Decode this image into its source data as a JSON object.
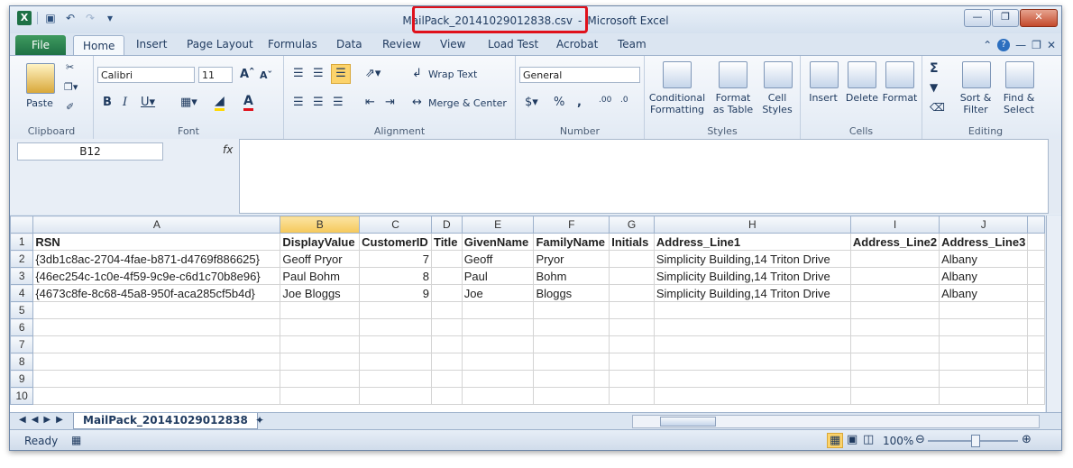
{
  "window": {
    "title_file": "MailPack_20141029012838.csv",
    "title_sep": "-",
    "title_app": "Microsoft Excel"
  },
  "ribbon_tabs": [
    "File",
    "Home",
    "Insert",
    "Page Layout",
    "Formulas",
    "Data",
    "Review",
    "View",
    "Load Test",
    "Acrobat",
    "Team"
  ],
  "ribbon": {
    "clipboard": {
      "label": "Clipboard",
      "paste": "Paste"
    },
    "font": {
      "label": "Font",
      "name": "Calibri",
      "size": "11"
    },
    "alignment": {
      "label": "Alignment",
      "wrap": "Wrap Text",
      "merge": "Merge & Center"
    },
    "number": {
      "label": "Number",
      "format": "General"
    },
    "styles": {
      "label": "Styles",
      "cond1": "Conditional",
      "cond2": "Formatting",
      "fmt1": "Format",
      "fmt2": "as Table",
      "cell1": "Cell",
      "cell2": "Styles"
    },
    "cells": {
      "label": "Cells",
      "insert": "Insert",
      "delete": "Delete",
      "format": "Format"
    },
    "editing": {
      "label": "Editing",
      "sort1": "Sort &",
      "sort2": "Filter",
      "find1": "Find &",
      "find2": "Select"
    }
  },
  "formula_bar": {
    "name_box": "B12",
    "fx": "fx",
    "value": ""
  },
  "columns": [
    "A",
    "B",
    "C",
    "D",
    "E",
    "F",
    "G",
    "H",
    "I",
    "J"
  ],
  "rows": [
    [
      "RSN",
      "DisplayValue",
      "CustomerID",
      "Title",
      "GivenName",
      "FamilyName",
      "Initials",
      "Address_Line1",
      "Address_Line2",
      "Address_Line3"
    ],
    [
      "{3db1c8ac-2704-4fae-b871-d4769f886625}",
      "Geoff Pryor",
      "7",
      "",
      "Geoff",
      "Pryor",
      "",
      "Simplicity Building,14 Triton Drive",
      "",
      "Albany"
    ],
    [
      "{46ec254c-1c0e-4f59-9c9e-c6d1c70b8e96}",
      "Paul Bohm",
      "8",
      "",
      "Paul",
      "Bohm",
      "",
      "Simplicity Building,14 Triton Drive",
      "",
      "Albany"
    ],
    [
      "{4673c8fe-8c68-45a8-950f-aca285cf5b4d}",
      "Joe Bloggs",
      "9",
      "",
      "Joe",
      "Bloggs",
      "",
      "Simplicity Building,14 Triton Drive",
      "",
      "Albany"
    ]
  ],
  "row_numbers": [
    "1",
    "2",
    "3",
    "4",
    "5",
    "6",
    "7",
    "8",
    "9",
    "10"
  ],
  "sheet_tab": "MailPack_20141029012838",
  "status": {
    "ready": "Ready",
    "zoom": "100%"
  }
}
